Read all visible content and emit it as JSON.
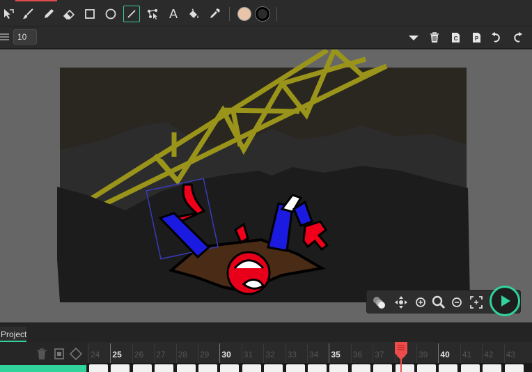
{
  "toolbar": {
    "tools": [
      {
        "name": "select-tool",
        "icon": "pointer-icon"
      },
      {
        "name": "brush-tool",
        "icon": "brush-icon"
      },
      {
        "name": "pencil-tool",
        "icon": "pencil-icon"
      },
      {
        "name": "eraser-tool",
        "icon": "eraser-icon"
      },
      {
        "name": "rectangle-tool",
        "icon": "rectangle-icon"
      },
      {
        "name": "ellipse-tool",
        "icon": "circle-icon"
      },
      {
        "name": "line-tool",
        "icon": "line-icon",
        "active": true
      },
      {
        "name": "path-tool",
        "icon": "path-icon"
      },
      {
        "name": "text-tool",
        "icon": "text-icon",
        "label": "A"
      },
      {
        "name": "fill-tool",
        "icon": "paint-bucket-icon"
      },
      {
        "name": "eyedropper-tool",
        "icon": "eyedropper-icon"
      }
    ],
    "fill_color": "#e9c4a8",
    "stroke_color": "#000000",
    "accent_color": "#3cc9a0"
  },
  "bar2": {
    "frame_value": "10",
    "buttons": [
      "dropdown-icon",
      "trash-icon",
      "copy-icon",
      "paste-icon",
      "undo-icon",
      "redo-icon"
    ]
  },
  "controls": {
    "buttons": [
      "onion-skin-icon",
      "move-icon",
      "zoom-in-icon",
      "search-icon",
      "zoom-out-icon",
      "fit-screen-icon"
    ],
    "play": "play-icon"
  },
  "timeline": {
    "tab_label": "Project",
    "tick_labels": [
      "24",
      "25",
      "26",
      "27",
      "28",
      "29",
      "30",
      "31",
      "32",
      "33",
      "34",
      "35",
      "36",
      "37",
      "38",
      "39",
      "40",
      "41",
      "42",
      "43"
    ],
    "major_ticks": [
      "25",
      "30",
      "35",
      "40"
    ],
    "current_frame": "38",
    "playhead_color": "#ef4b4b"
  }
}
